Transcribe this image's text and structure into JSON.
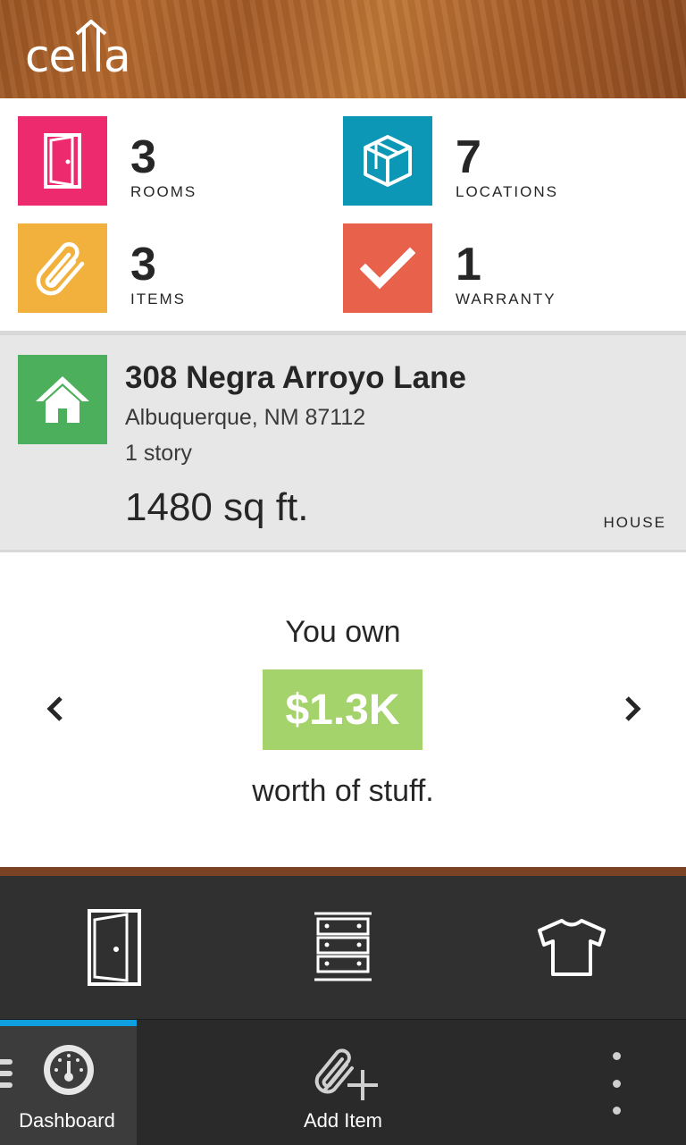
{
  "app": {
    "logo_text": "cella"
  },
  "stats": [
    {
      "value": "3",
      "label": "ROOMS",
      "icon": "door-icon",
      "color": "#ee2a6f"
    },
    {
      "value": "7",
      "label": "LOCATIONS",
      "icon": "box-icon",
      "color": "#0c97b6"
    },
    {
      "value": "3",
      "label": "ITEMS",
      "icon": "paperclip-icon",
      "color": "#f2b03c"
    },
    {
      "value": "1",
      "label": "WARRANTY",
      "icon": "checkmark-icon",
      "color": "#e8614a"
    }
  ],
  "property": {
    "address": "308 Negra Arroyo Lane",
    "city": "Albuquerque, NM 87112",
    "stories": "1 story",
    "size": "1480 sq ft.",
    "type": "HOUSE",
    "icon": "house-icon",
    "color": "#4caf5b"
  },
  "value": {
    "prefix": "You own",
    "amount": "$1.3K",
    "suffix": "worth of stuff.",
    "accent": "#a4d36b"
  },
  "shortcuts": [
    {
      "icon": "door-outline-icon"
    },
    {
      "icon": "dresser-icon"
    },
    {
      "icon": "tshirt-icon"
    }
  ],
  "actionbar": {
    "dashboard_label": "Dashboard",
    "add_item_label": "Add Item",
    "active_color": "#0f9ee0"
  }
}
